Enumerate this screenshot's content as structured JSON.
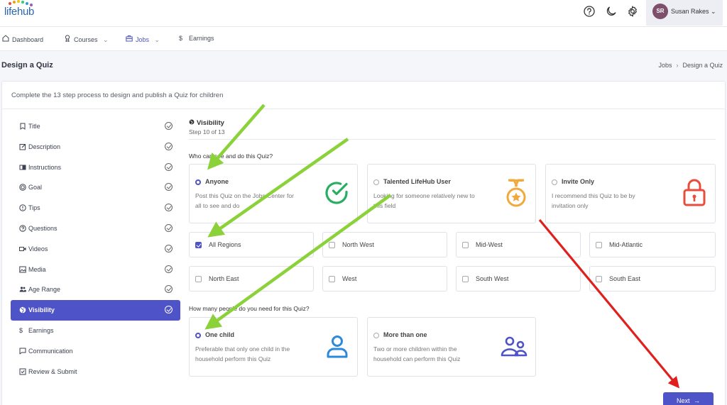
{
  "app": {
    "logo_text": "lifehub"
  },
  "topbar": {
    "help_icon": "question-circle-icon",
    "theme_icon": "moon-icon",
    "settings_icon": "gear-icon",
    "user_initials": "SR",
    "user_name": "Susan Rakes",
    "user_chevron": "⌄"
  },
  "nav": {
    "items": [
      {
        "label": "Dashboard",
        "icon": "home-icon"
      },
      {
        "label": "Courses",
        "icon": "award-icon"
      },
      {
        "label": "Jobs",
        "icon": "briefcase-icon"
      },
      {
        "label": "Earnings",
        "icon": "dollar-icon"
      }
    ],
    "chevron": "⌄"
  },
  "page": {
    "title": "Design a Quiz",
    "breadcrumb": [
      "Jobs",
      "Design a Quiz"
    ],
    "breadcrumb_sep": "›"
  },
  "card": {
    "intro": "Complete the 13 step process to design and publish a Quiz for children"
  },
  "steps": [
    {
      "label": "Title",
      "icon": "bookmark-icon"
    },
    {
      "label": "Description",
      "icon": "edit-icon"
    },
    {
      "label": "Instructions",
      "icon": "book-icon"
    },
    {
      "label": "Goal",
      "icon": "target-icon"
    },
    {
      "label": "Tips",
      "icon": "alert-circle-icon"
    },
    {
      "label": "Questions",
      "icon": "help-circle-icon"
    },
    {
      "label": "Videos",
      "icon": "video-icon"
    },
    {
      "label": "Media",
      "icon": "image-icon"
    },
    {
      "label": "Age Range",
      "icon": "users-icon"
    },
    {
      "label": "Visibility",
      "icon": "globe-icon",
      "active": true
    },
    {
      "label": "Earnings",
      "icon": "dollar-icon"
    },
    {
      "label": "Communication",
      "icon": "message-icon"
    },
    {
      "label": "Review & Submit",
      "icon": "check-square-icon"
    }
  ],
  "section": {
    "title": "Visibility",
    "step": "Step 10 of 13",
    "q1": "Who can see and do this Quiz?",
    "q2": "How many people do you need for this Quiz?"
  },
  "audience_options": [
    {
      "title": "Anyone",
      "desc": "Post this Quiz on the Jobs Center for all to see and do",
      "icon": "check-circle-icon",
      "selected": true
    },
    {
      "title": "Talented LifeHub User",
      "desc": "Looking for someone relatively new to this field",
      "icon": "medal-icon",
      "selected": false
    },
    {
      "title": "Invite Only",
      "desc": "I recommend this Quiz to be by invitation only",
      "icon": "lock-icon",
      "selected": false
    }
  ],
  "regions": [
    {
      "label": "All Regions",
      "checked": true
    },
    {
      "label": "North West",
      "checked": false
    },
    {
      "label": "Mid-West",
      "checked": false
    },
    {
      "label": "Mid-Atlantic",
      "checked": false
    },
    {
      "label": "North East",
      "checked": false
    },
    {
      "label": "West",
      "checked": false
    },
    {
      "label": "South West",
      "checked": false
    },
    {
      "label": "South East",
      "checked": false
    }
  ],
  "people_options": [
    {
      "title": "One child",
      "desc": "Preferable that only one child in the household perform this Quiz",
      "icon": "user-icon",
      "selected": true
    },
    {
      "title": "More than one",
      "desc": "Two or more children within the household can perform this Quiz",
      "icon": "users-icon",
      "selected": false
    }
  ],
  "actions": {
    "next_label": "Next",
    "next_arrow": "→"
  },
  "colors": {
    "accent": "#4e54c8",
    "success": "#27ae60",
    "medal": "#f2a93b",
    "lock": "#e74c3c",
    "icon_blue": "#2d8ad8",
    "annotation_green": "#8bd23a",
    "annotation_red": "#e0201c"
  }
}
